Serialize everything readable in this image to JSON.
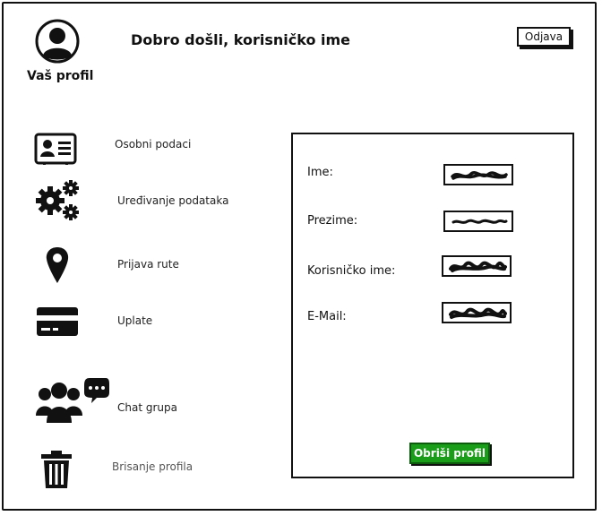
{
  "header": {
    "profile_label": "Vaš profil",
    "welcome_text": "Dobro došli, korisničko ime",
    "logout_label": "Odjava"
  },
  "sidebar": {
    "items": [
      {
        "label": "Osobni podaci",
        "icon": "id-card-icon"
      },
      {
        "label": "Uređivanje podataka",
        "icon": "gears-icon"
      },
      {
        "label": "Prijava rute",
        "icon": "map-pin-icon"
      },
      {
        "label": "Uplate",
        "icon": "credit-card-icon"
      },
      {
        "label": "Chat grupa",
        "icon": "group-chat-icon"
      },
      {
        "label": "Brisanje profila",
        "icon": "trash-icon"
      }
    ]
  },
  "profile_panel": {
    "fields": [
      {
        "label": "Ime:",
        "value": ""
      },
      {
        "label": "Prezime:",
        "value": ""
      },
      {
        "label": "Korisničko ime:",
        "value": ""
      },
      {
        "label": "E-Mail:",
        "value": ""
      }
    ],
    "delete_label": "Obriši profil"
  },
  "colors": {
    "delete_button": "#1a9e1a",
    "ink": "#111111"
  }
}
